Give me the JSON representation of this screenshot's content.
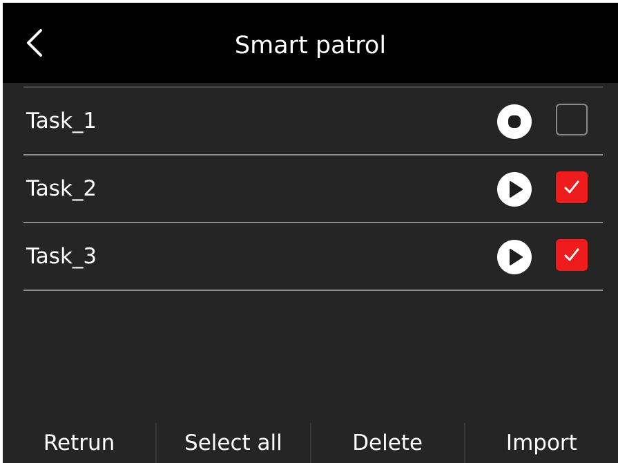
{
  "header": {
    "back_icon": "chevron-left-icon",
    "title": "Smart patrol"
  },
  "tasks": [
    {
      "label": "Task_1",
      "state": "stop",
      "action_icon": "stop-circle-icon",
      "checked": false
    },
    {
      "label": "Task_2",
      "state": "play",
      "action_icon": "play-circle-icon",
      "checked": true
    },
    {
      "label": "Task_3",
      "state": "play",
      "action_icon": "play-circle-icon",
      "checked": true
    }
  ],
  "footer": {
    "return_label": "Retrun",
    "select_all_label": "Select all",
    "delete_label": "Delete",
    "import_label": "Import"
  },
  "colors": {
    "background": "#252525",
    "header": "#000000",
    "accent_checked": "#ee1c1c",
    "text": "#ffffff"
  }
}
